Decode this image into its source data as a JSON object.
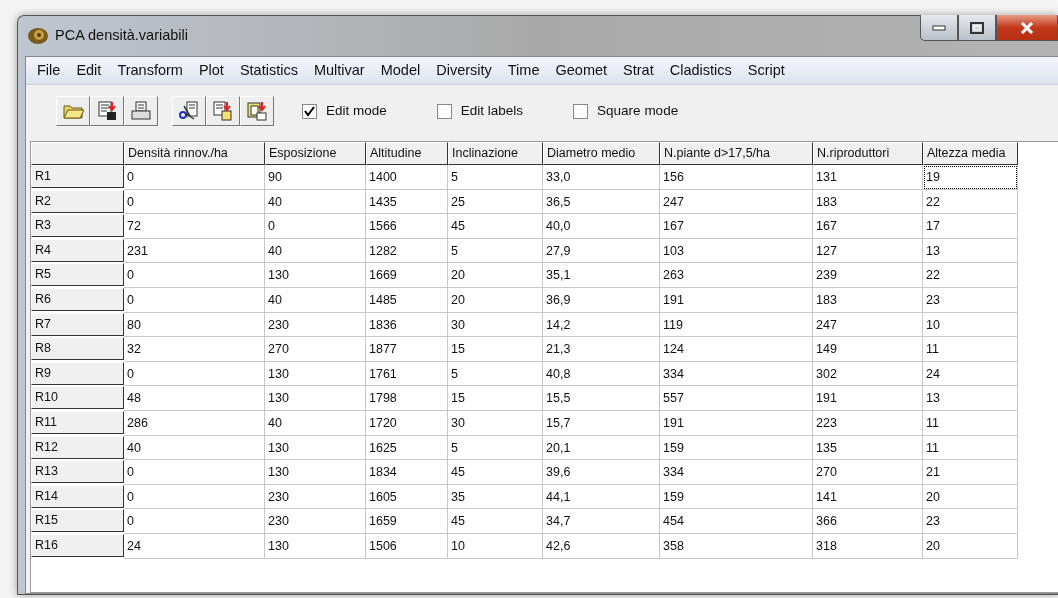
{
  "window": {
    "title": "PCA densità.variabili"
  },
  "menu": [
    "File",
    "Edit",
    "Transform",
    "Plot",
    "Statistics",
    "Multivar",
    "Model",
    "Diversity",
    "Time",
    "Geomet",
    "Strat",
    "Cladistics",
    "Script"
  ],
  "toolbar": {
    "groups": [
      [
        {
          "kind": "open"
        },
        {
          "kind": "save"
        },
        {
          "kind": "print"
        }
      ],
      [
        {
          "kind": "cut"
        },
        {
          "kind": "copy"
        },
        {
          "kind": "paste"
        }
      ]
    ],
    "checkboxes": [
      {
        "label": "Edit mode",
        "checked": true
      },
      {
        "label": "Edit labels",
        "checked": false
      },
      {
        "label": "Square mode",
        "checked": false
      }
    ]
  },
  "table": {
    "columns": [
      "Densità rinnov./ha",
      "Esposizione",
      "Altitudine",
      "Inclinazione",
      "Diametro medio",
      "N.piante d>17,5/ha",
      "N.riproduttori",
      "Altezza media"
    ],
    "rows": [
      {
        "label": "R1",
        "cells": [
          {
            "text": "0",
            "focused": false
          },
          {
            "text": "90",
            "focused": false
          },
          {
            "text": "1400",
            "focused": false
          },
          {
            "text": "5",
            "focused": false
          },
          {
            "text": "33,0",
            "focused": false
          },
          {
            "text": "156",
            "focused": false
          },
          {
            "text": "131",
            "focused": false
          },
          {
            "text": "19",
            "focused": true
          }
        ]
      },
      {
        "label": "R2",
        "cells": [
          {
            "text": "0",
            "focused": false
          },
          {
            "text": "40",
            "focused": false
          },
          {
            "text": "1435",
            "focused": false
          },
          {
            "text": "25",
            "focused": false
          },
          {
            "text": "36,5",
            "focused": false
          },
          {
            "text": "247",
            "focused": false
          },
          {
            "text": "183",
            "focused": false
          },
          {
            "text": "22",
            "focused": false
          }
        ]
      },
      {
        "label": "R3",
        "cells": [
          {
            "text": "72",
            "focused": false
          },
          {
            "text": "0",
            "focused": false
          },
          {
            "text": "1566",
            "focused": false
          },
          {
            "text": "45",
            "focused": false
          },
          {
            "text": "40,0",
            "focused": false
          },
          {
            "text": "167",
            "focused": false
          },
          {
            "text": "167",
            "focused": false
          },
          {
            "text": "17",
            "focused": false
          }
        ]
      },
      {
        "label": "R4",
        "cells": [
          {
            "text": "231",
            "focused": false
          },
          {
            "text": "40",
            "focused": false
          },
          {
            "text": "1282",
            "focused": false
          },
          {
            "text": "5",
            "focused": false
          },
          {
            "text": "27,9",
            "focused": false
          },
          {
            "text": "103",
            "focused": false
          },
          {
            "text": "127",
            "focused": false
          },
          {
            "text": "13",
            "focused": false
          }
        ]
      },
      {
        "label": "R5",
        "cells": [
          {
            "text": "0",
            "focused": false
          },
          {
            "text": "130",
            "focused": false
          },
          {
            "text": "1669",
            "focused": false
          },
          {
            "text": "20",
            "focused": false
          },
          {
            "text": "35,1",
            "focused": false
          },
          {
            "text": "263",
            "focused": false
          },
          {
            "text": "239",
            "focused": false
          },
          {
            "text": "22",
            "focused": false
          }
        ]
      },
      {
        "label": "R6",
        "cells": [
          {
            "text": "0",
            "focused": false
          },
          {
            "text": "40",
            "focused": false
          },
          {
            "text": "1485",
            "focused": false
          },
          {
            "text": "20",
            "focused": false
          },
          {
            "text": "36,9",
            "focused": false
          },
          {
            "text": "191",
            "focused": false
          },
          {
            "text": "183",
            "focused": false
          },
          {
            "text": "23",
            "focused": false
          }
        ]
      },
      {
        "label": "R7",
        "cells": [
          {
            "text": "80",
            "focused": false
          },
          {
            "text": "230",
            "focused": false
          },
          {
            "text": "1836",
            "focused": false
          },
          {
            "text": "30",
            "focused": false
          },
          {
            "text": "14,2",
            "focused": false
          },
          {
            "text": "119",
            "focused": false
          },
          {
            "text": "247",
            "focused": false
          },
          {
            "text": "10",
            "focused": false
          }
        ]
      },
      {
        "label": "R8",
        "cells": [
          {
            "text": "32",
            "focused": false
          },
          {
            "text": "270",
            "focused": false
          },
          {
            "text": "1877",
            "focused": false
          },
          {
            "text": "15",
            "focused": false
          },
          {
            "text": "21,3",
            "focused": false
          },
          {
            "text": "124",
            "focused": false
          },
          {
            "text": "149",
            "focused": false
          },
          {
            "text": "11",
            "focused": false
          }
        ]
      },
      {
        "label": "R9",
        "cells": [
          {
            "text": "0",
            "focused": false
          },
          {
            "text": "130",
            "focused": false
          },
          {
            "text": "1761",
            "focused": false
          },
          {
            "text": "5",
            "focused": false
          },
          {
            "text": "40,8",
            "focused": false
          },
          {
            "text": "334",
            "focused": false
          },
          {
            "text": "302",
            "focused": false
          },
          {
            "text": "24",
            "focused": false
          }
        ]
      },
      {
        "label": "R10",
        "cells": [
          {
            "text": "48",
            "focused": false
          },
          {
            "text": "130",
            "focused": false
          },
          {
            "text": "1798",
            "focused": false
          },
          {
            "text": "15",
            "focused": false
          },
          {
            "text": "15,5",
            "focused": false
          },
          {
            "text": "557",
            "focused": false
          },
          {
            "text": "191",
            "focused": false
          },
          {
            "text": "13",
            "focused": false
          }
        ]
      },
      {
        "label": "R11",
        "cells": [
          {
            "text": "286",
            "focused": false
          },
          {
            "text": "40",
            "focused": false
          },
          {
            "text": "1720",
            "focused": false
          },
          {
            "text": "30",
            "focused": false
          },
          {
            "text": "15,7",
            "focused": false
          },
          {
            "text": "191",
            "focused": false
          },
          {
            "text": "223",
            "focused": false
          },
          {
            "text": "11",
            "focused": false
          }
        ]
      },
      {
        "label": "R12",
        "cells": [
          {
            "text": "40",
            "focused": false
          },
          {
            "text": "130",
            "focused": false
          },
          {
            "text": "1625",
            "focused": false
          },
          {
            "text": "5",
            "focused": false
          },
          {
            "text": "20,1",
            "focused": false
          },
          {
            "text": "159",
            "focused": false
          },
          {
            "text": "135",
            "focused": false
          },
          {
            "text": "11",
            "focused": false
          }
        ]
      },
      {
        "label": "R13",
        "cells": [
          {
            "text": "0",
            "focused": false
          },
          {
            "text": "130",
            "focused": false
          },
          {
            "text": "1834",
            "focused": false
          },
          {
            "text": "45",
            "focused": false
          },
          {
            "text": "39,6",
            "focused": false
          },
          {
            "text": "334",
            "focused": false
          },
          {
            "text": "270",
            "focused": false
          },
          {
            "text": "21",
            "focused": false
          }
        ]
      },
      {
        "label": "R14",
        "cells": [
          {
            "text": "0",
            "focused": false
          },
          {
            "text": "230",
            "focused": false
          },
          {
            "text": "1605",
            "focused": false
          },
          {
            "text": "35",
            "focused": false
          },
          {
            "text": "44,1",
            "focused": false
          },
          {
            "text": "159",
            "focused": false
          },
          {
            "text": "141",
            "focused": false
          },
          {
            "text": "20",
            "focused": false
          }
        ]
      },
      {
        "label": "R15",
        "cells": [
          {
            "text": "0",
            "focused": false
          },
          {
            "text": "230",
            "focused": false
          },
          {
            "text": "1659",
            "focused": false
          },
          {
            "text": "45",
            "focused": false
          },
          {
            "text": "34,7",
            "focused": false
          },
          {
            "text": "454",
            "focused": false
          },
          {
            "text": "366",
            "focused": false
          },
          {
            "text": "23",
            "focused": false
          }
        ]
      },
      {
        "label": "R16",
        "cells": [
          {
            "text": "24",
            "focused": false
          },
          {
            "text": "130",
            "focused": false
          },
          {
            "text": "1506",
            "focused": false
          },
          {
            "text": "10",
            "focused": false
          },
          {
            "text": "42,6",
            "focused": false
          },
          {
            "text": "358",
            "focused": false
          },
          {
            "text": "318",
            "focused": false
          },
          {
            "text": "20",
            "focused": false
          }
        ]
      }
    ]
  }
}
